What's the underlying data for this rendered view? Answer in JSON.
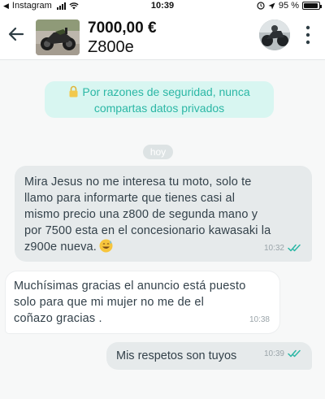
{
  "status_bar": {
    "back_app": "Instagram",
    "time": "10:39",
    "battery": "95 %",
    "battery_level": 0.95
  },
  "header": {
    "price": "7000,00 €",
    "product": "Z800e"
  },
  "chat": {
    "security_notice": {
      "line1": "Por razones de seguridad, nunca",
      "line2": "compartas datos privados"
    },
    "day_separator": "hoy",
    "messages": [
      {
        "direction": "outgoing",
        "lines": [
          "Mira Jesus no me interesa tu moto, solo te",
          "llamo para informarte que tienes casi al",
          "mismo precio una z800 de segunda mano y",
          "por 7500 esta en el concesionario kawasaki la",
          "z900e nueva."
        ],
        "emoji": "grinning-sweat-emoji",
        "time": "10:32",
        "status": "read"
      },
      {
        "direction": "incoming",
        "lines": [
          "Muchísimas gracias el anuncio está puesto",
          "solo para que mi mujer no me de el",
          "coñazo gracias ."
        ],
        "time": "10:38"
      },
      {
        "direction": "outgoing",
        "lines": [
          "Mis respetos son tuyos"
        ],
        "time": "10:39",
        "status": "read"
      }
    ]
  },
  "colors": {
    "accent_teal": "#2bb7a5",
    "notice_bg": "#d8f6f1",
    "outgoing_bubble": "#e6eaeb",
    "chat_bg": "#f7f8f8"
  }
}
